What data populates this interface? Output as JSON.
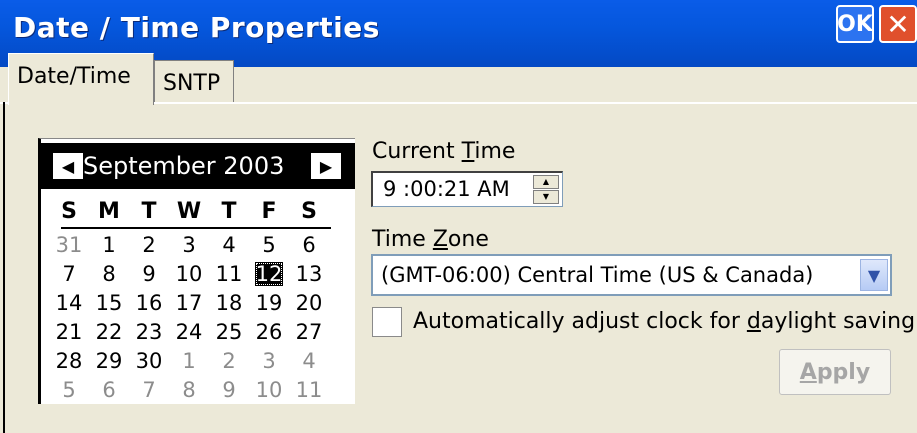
{
  "window": {
    "title": "Date / Time Properties",
    "ok_label": "OK",
    "close_icon": "close-icon"
  },
  "tabs": [
    {
      "label": "Date/Time"
    },
    {
      "label": "SNTP"
    }
  ],
  "calendar": {
    "month_year": "September 2003",
    "days_of_week": [
      "S",
      "M",
      "T",
      "W",
      "T",
      "F",
      "S"
    ],
    "weeks": [
      [
        "31",
        "1",
        "2",
        "3",
        "4",
        "5",
        "6"
      ],
      [
        "7",
        "8",
        "9",
        "10",
        "11",
        "12",
        "13"
      ],
      [
        "14",
        "15",
        "16",
        "17",
        "18",
        "19",
        "20"
      ],
      [
        "21",
        "22",
        "23",
        "24",
        "25",
        "26",
        "27"
      ],
      [
        "28",
        "29",
        "30",
        "1",
        "2",
        "3",
        "4"
      ],
      [
        "5",
        "6",
        "7",
        "8",
        "9",
        "10",
        "11"
      ]
    ],
    "selected_day": "12"
  },
  "time": {
    "label_pre": "Current ",
    "label_ul": "T",
    "label_post": "ime",
    "value": "9 :00:21 AM"
  },
  "timezone": {
    "label_pre": "Time ",
    "label_ul": "Z",
    "label_post": "one",
    "value": "(GMT-06:00) Central Time (US & Canada)"
  },
  "daylight": {
    "label_pre": "Automatically adjust clock for ",
    "label_ul": "d",
    "label_post": "aylight saving",
    "checked": false
  },
  "apply": {
    "label_ul": "A",
    "label_post": "pply"
  }
}
